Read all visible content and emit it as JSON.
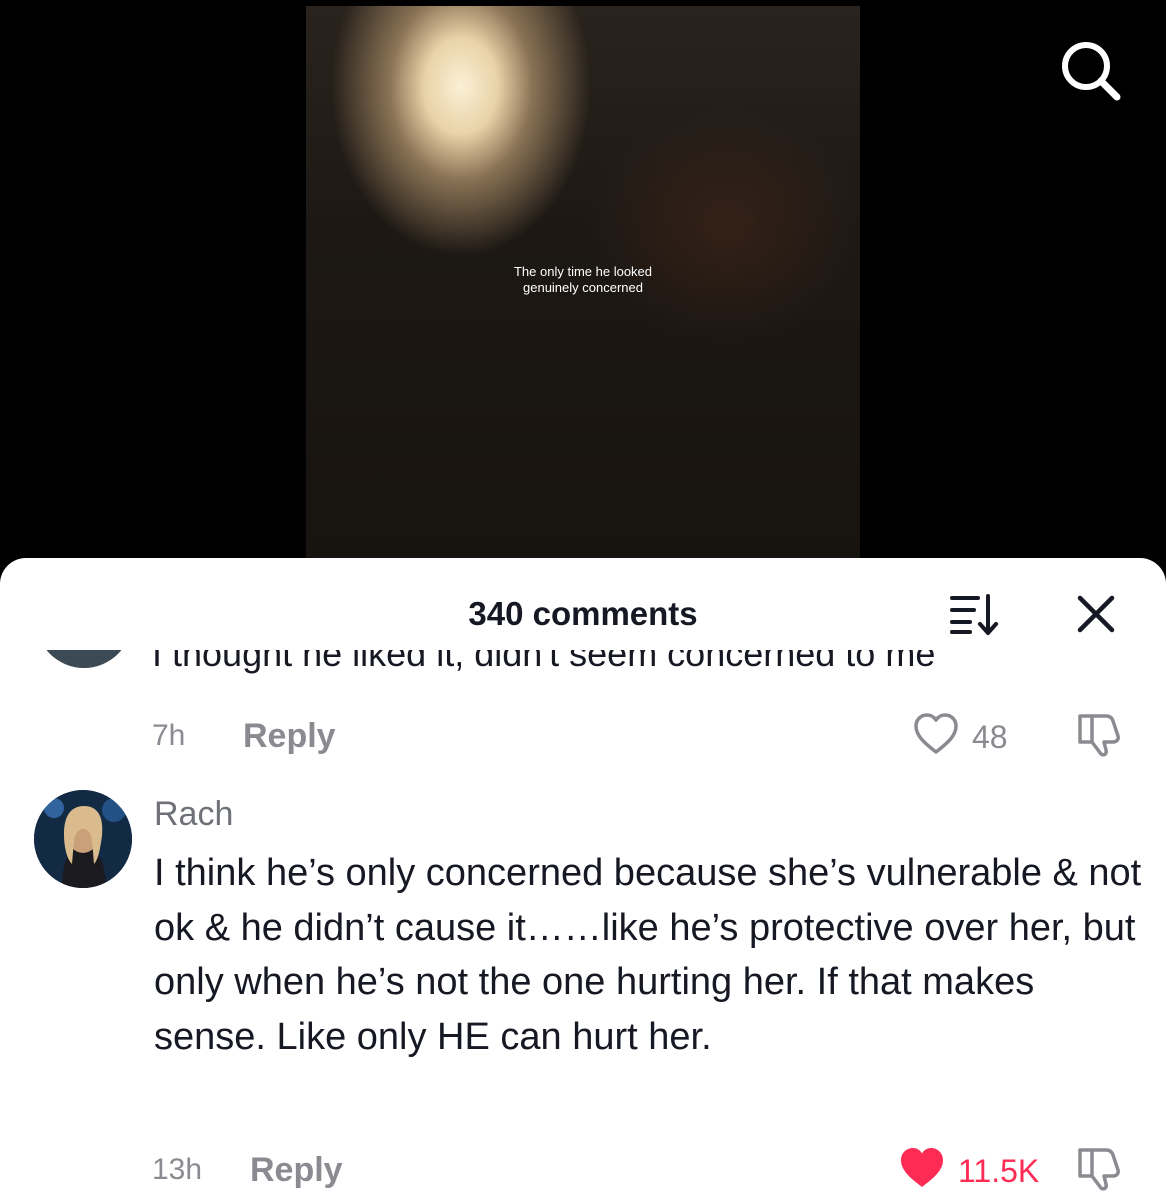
{
  "video": {
    "caption_line1": "The only time he looked",
    "caption_line2": "genuinely concerned",
    "search_icon": "search-icon"
  },
  "comments_panel": {
    "count_label": "340 comments",
    "sort_icon": "sort-icon",
    "close_icon": "close-icon",
    "accent_color": "#fe2c55",
    "comments": [
      {
        "text": "I thought he liked it, didn't seem concerned to me",
        "time": "7h",
        "reply_label": "Reply",
        "likes": "48",
        "liked": false
      },
      {
        "username": "Rach",
        "text": "I think he’s only concerned because she’s vulnerable & not ok & he didn’t cause it……like he’s protective over her, but only when he’s not the one hurting her. If that makes sense. Like only HE can hurt her.",
        "time": "13h",
        "reply_label": "Reply",
        "likes": "11.5K",
        "liked": true
      }
    ]
  }
}
